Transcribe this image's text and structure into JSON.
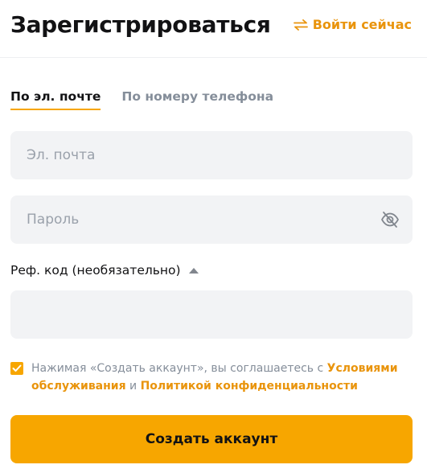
{
  "header": {
    "title": "Зарегистрироваться",
    "login_link": "Войти сейчас"
  },
  "tabs": [
    {
      "label": "По эл. почте",
      "active": true
    },
    {
      "label": "По номеру телефона",
      "active": false
    }
  ],
  "fields": {
    "email_placeholder": "Эл. почта",
    "password_placeholder": "Пароль",
    "ref_label": "Реф. код (необязательно)",
    "ref_value": ""
  },
  "agreement": {
    "prefix": "Нажимая «Создать аккаунт», вы соглашаетесь с ",
    "terms_link": "Условиями обслуживания",
    "middle": " и ",
    "privacy_link": "Политикой конфиденциальности",
    "checked": true
  },
  "submit_label": "Создать аккаунт",
  "colors": {
    "accent": "#f7a600",
    "link": "#e9940c",
    "field_bg": "#f2f3f5",
    "muted_text": "#858e9a"
  }
}
